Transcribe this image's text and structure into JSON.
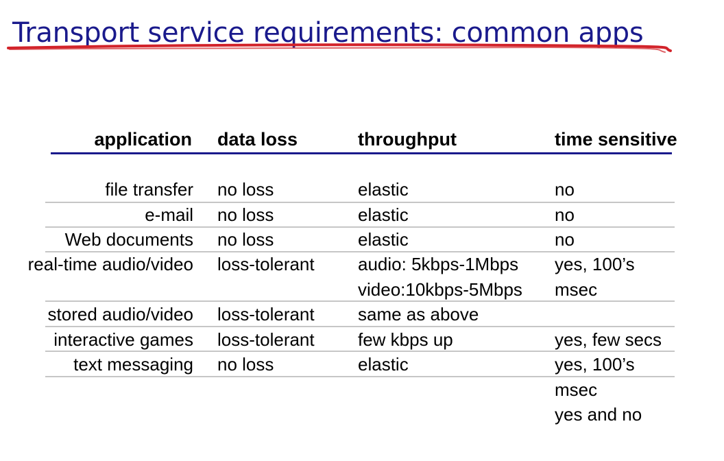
{
  "slide": {
    "title": "Transport service requirements: common apps",
    "accent_color": "#1a1a8c",
    "underline_color": "#d2232a"
  },
  "table": {
    "headers": {
      "application": "application",
      "data_loss": "data loss",
      "throughput": "throughput",
      "time_sensitive": "time sensitive"
    },
    "rows": [
      {
        "application": "file transfer",
        "data_loss": "no loss",
        "throughput": [
          "elastic"
        ],
        "time_sensitive": [
          "no"
        ]
      },
      {
        "application": "e-mail",
        "data_loss": "no loss",
        "throughput": [
          "elastic"
        ],
        "time_sensitive": [
          "no"
        ]
      },
      {
        "application": "Web documents",
        "data_loss": "no loss",
        "throughput": [
          "elastic"
        ],
        "time_sensitive": [
          "no"
        ]
      },
      {
        "application": "real-time audio/video",
        "data_loss": "loss-tolerant",
        "throughput": [
          "audio: 5kbps-1Mbps",
          "video:10kbps-5Mbps"
        ],
        "time_sensitive": [
          "yes, 100’s",
          "msec"
        ]
      },
      {
        "application": "stored audio/video",
        "data_loss": "loss-tolerant",
        "throughput": [
          "same as above"
        ],
        "time_sensitive": []
      },
      {
        "application": "interactive games",
        "data_loss": "loss-tolerant",
        "throughput": [
          "few kbps up"
        ],
        "time_sensitive": [
          "yes, few secs"
        ]
      },
      {
        "application": "text messaging",
        "data_loss": "no loss",
        "throughput": [
          "elastic"
        ],
        "time_sensitive": [
          "yes, 100’s",
          "msec",
          "yes and no"
        ]
      }
    ]
  }
}
